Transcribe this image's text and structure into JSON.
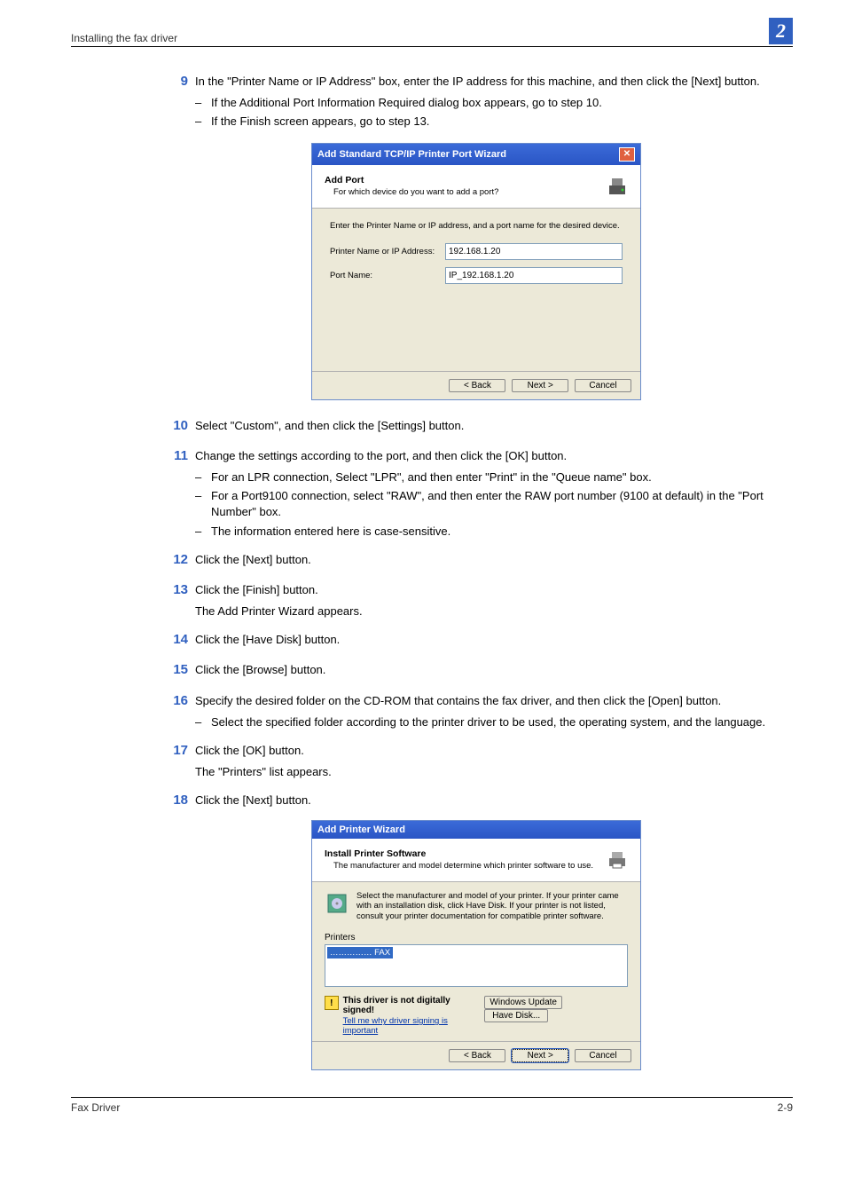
{
  "header": {
    "section": "Installing the fax driver",
    "chapter": "2"
  },
  "steps": {
    "s9": {
      "num": "9",
      "text": "In the \"Printer Name or IP Address\" box, enter the IP address for this machine, and then click the [Next] button.",
      "sub": [
        "If the Additional Port Information Required dialog box appears, go to step 10.",
        "If the Finish screen appears, go to step 13."
      ]
    },
    "s10": {
      "num": "10",
      "text": "Select \"Custom\", and then click the [Settings] button."
    },
    "s11": {
      "num": "11",
      "text": "Change the settings according to the port, and then click the [OK] button.",
      "sub": [
        "For an LPR connection, Select \"LPR\", and then enter \"Print\" in the \"Queue name\" box.",
        "For a Port9100 connection, select \"RAW\", and then enter the RAW port number (9100 at default) in the \"Port Number\" box.",
        "The information entered here is case-sensitive."
      ]
    },
    "s12": {
      "num": "12",
      "text": "Click the [Next] button."
    },
    "s13": {
      "num": "13",
      "text": "Click the [Finish] button.",
      "note": "The Add Printer Wizard appears."
    },
    "s14": {
      "num": "14",
      "text": "Click the [Have Disk] button."
    },
    "s15": {
      "num": "15",
      "text": "Click the [Browse] button."
    },
    "s16": {
      "num": "16",
      "text": "Specify the desired folder on the CD-ROM that contains the fax driver, and then click the [Open] button.",
      "sub": [
        "Select the specified folder according to the printer driver to be used, the operating system, and the language."
      ]
    },
    "s17": {
      "num": "17",
      "text": "Click the [OK] button.",
      "note": "The \"Printers\" list appears."
    },
    "s18": {
      "num": "18",
      "text": "Click the [Next] button."
    }
  },
  "dialog1": {
    "title": "Add Standard TCP/IP Printer Port Wizard",
    "hdr_bold": "Add Port",
    "hdr_sub": "For which device do you want to add a port?",
    "instr": "Enter the Printer Name or IP address, and a port name for the desired device.",
    "label_addr": "Printer Name or IP Address:",
    "val_addr": "192.168.1.20",
    "label_port": "Port Name:",
    "val_port": "IP_192.168.1.20",
    "back": "< Back",
    "next": "Next >",
    "cancel": "Cancel"
  },
  "dialog2": {
    "title": "Add Printer Wizard",
    "hdr_bold": "Install Printer Software",
    "hdr_sub": "The manufacturer and model determine which printer software to use.",
    "info": "Select the manufacturer and model of your printer. If your printer came with an installation disk, click Have Disk. If your printer is not listed, consult your printer documentation for compatible printer software.",
    "list_label": "Printers",
    "list_item": "…………… FAX",
    "warn": "This driver is not digitally signed!",
    "warn_link": "Tell me why driver signing is important",
    "winupdate": "Windows Update",
    "havedisk": "Have Disk...",
    "back": "< Back",
    "next": "Next >",
    "cancel": "Cancel"
  },
  "footer": {
    "left": "Fax Driver",
    "right": "2-9"
  }
}
